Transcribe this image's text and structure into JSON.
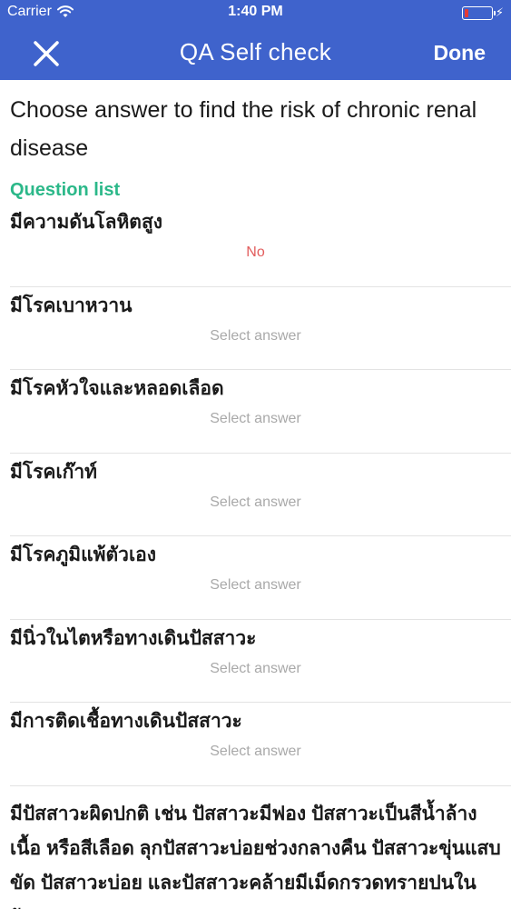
{
  "status_bar": {
    "carrier": "Carrier",
    "time": "1:40 PM",
    "battery_level": 0.15,
    "battery_color": "#e53935"
  },
  "nav": {
    "title": "QA Self check",
    "done_label": "Done",
    "close_icon": "close-icon",
    "background": "#3f63cc"
  },
  "intro": "Choose answer to find the risk of chronic renal disease",
  "section_label": "Question list",
  "section_color": "#2bb889",
  "questions": [
    {
      "text": "มีความดันโลหิตสูง",
      "answer": "No"
    },
    {
      "text": "มีโรคเบาหวาน",
      "answer": "Select answer"
    },
    {
      "text": "มีโรคหัวใจและหลอดเลือด",
      "answer": "Select answer"
    },
    {
      "text": "มีโรคเก๊าท์",
      "answer": "Select answer"
    },
    {
      "text": "มีโรคภูมิแพ้ตัวเอง",
      "answer": "Select answer"
    },
    {
      "text": "มีนิ่วในไตหรือทางเดินปัสสาวะ",
      "answer": "Select answer"
    },
    {
      "text": "มีการติดเชื้อทางเดินปัสสาวะ",
      "answer": "Select answer"
    },
    {
      "text": "มีปัสสาวะผิดปกติ เช่น ปัสสาวะมีฟอง ปัสสาวะเป็นสีน้ำล้างเนื้อ หรือสีเลือด ลุกปัสสาวะบ่อยช่วงกลางคืน  ปัสสาวะขุ่นแสบขัด ปัสสาวะบ่อย และปัสสาวะคล้ายมีเม็ดกรวดทรายปนในปัสสาวะ"
    }
  ]
}
